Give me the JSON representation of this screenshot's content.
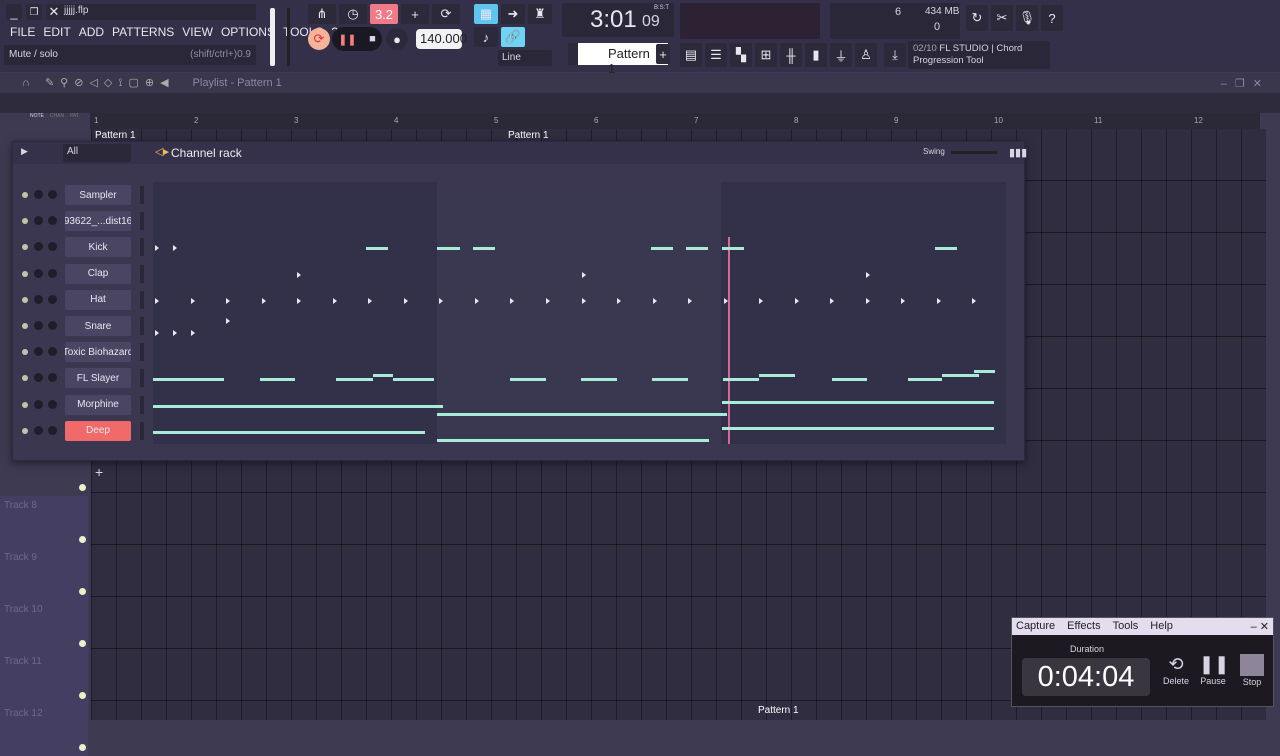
{
  "toolbar": {
    "file": "jjjjj.flp",
    "menu": [
      "FILE",
      "EDIT",
      "ADD",
      "PATTERNS",
      "VIEW",
      "OPTIONS",
      "TOOLS",
      "?"
    ],
    "hint": "Mute / solo",
    "hint_shortcut": "(shift/ctrl+)0.9",
    "tempo": "140.000",
    "time": "3:01",
    "time_sub": "09",
    "time_label": "B:S:T",
    "snap": "Line",
    "pattern": "Pattern 1",
    "cpu": "6",
    "mem": "434 MB",
    "poly": "0",
    "news": "02/10",
    "news_title": "FL STUDIO | Chord Progression Tool",
    "countdown": "3.2"
  },
  "playlist": {
    "title": "Playlist - Pattern 1",
    "tabs": [
      "NOTE",
      "CHAN",
      "PAT"
    ],
    "ruler": [
      "1",
      "2",
      "3",
      "4",
      "5",
      "6",
      "7",
      "8",
      "9",
      "10",
      "11",
      "12"
    ],
    "clips": [
      "Pattern 1",
      "Pattern 1",
      "Pattern 1"
    ],
    "tracks": [
      "Track 8",
      "Track 9",
      "Track 10",
      "Track 11",
      "Track 12"
    ]
  },
  "channel_rack": {
    "title": "Channel rack",
    "filter": "All",
    "swing": "Swing",
    "add": "+",
    "total_steps": 48,
    "channels": [
      {
        "name": "Sampler",
        "selected": false,
        "notes": [],
        "marks": []
      },
      {
        "name": "93622_...dist16",
        "selected": false,
        "notes": [],
        "marks": []
      },
      {
        "name": "Kick",
        "selected": false,
        "notes": [
          [
            12,
            1.25,
            0
          ],
          [
            16,
            1.25,
            0
          ],
          [
            18,
            1.25,
            0
          ],
          [
            28,
            1.25,
            0
          ],
          [
            30,
            1.25,
            0
          ],
          [
            32,
            1.25,
            0
          ],
          [
            44,
            1.25,
            0
          ]
        ],
        "marks": [
          [
            0,
            0
          ],
          [
            1,
            0
          ]
        ]
      },
      {
        "name": "Clap",
        "selected": false,
        "notes": [],
        "marks": [
          [
            8,
            0
          ],
          [
            24,
            0
          ],
          [
            40,
            0
          ]
        ]
      },
      {
        "name": "Hat",
        "selected": false,
        "notes": [],
        "marks": [
          [
            0,
            0
          ],
          [
            2,
            0
          ],
          [
            4,
            0
          ],
          [
            6,
            0
          ],
          [
            8,
            0
          ],
          [
            10,
            0
          ],
          [
            12,
            0
          ],
          [
            14,
            0
          ],
          [
            16,
            0
          ],
          [
            18,
            0
          ],
          [
            20,
            0
          ],
          [
            22,
            0
          ],
          [
            24,
            0
          ],
          [
            26,
            0
          ],
          [
            28,
            0
          ],
          [
            30,
            0
          ],
          [
            32,
            0
          ],
          [
            34,
            0
          ],
          [
            36,
            0
          ],
          [
            38,
            0
          ],
          [
            40,
            0
          ],
          [
            42,
            0
          ],
          [
            44,
            0
          ],
          [
            46,
            0
          ]
        ]
      },
      {
        "name": "Snare",
        "selected": false,
        "notes": [],
        "marks": [
          [
            0,
            -1
          ],
          [
            1,
            -1
          ],
          [
            2,
            -1
          ],
          [
            4,
            1
          ]
        ]
      },
      {
        "name": "Toxic Biohazard",
        "selected": false,
        "notes": [],
        "marks": []
      },
      {
        "name": "FL Slayer",
        "selected": false,
        "notes": [
          [
            0,
            2,
            0
          ],
          [
            2,
            2,
            0
          ],
          [
            6,
            2,
            0
          ],
          [
            10.3,
            2.1,
            0
          ],
          [
            12.4,
            1.1,
            1
          ],
          [
            13.5,
            2.3,
            0
          ],
          [
            20.1,
            2,
            0
          ],
          [
            24.1,
            2,
            0
          ],
          [
            28.1,
            2,
            0
          ],
          [
            32.1,
            2,
            0
          ],
          [
            34.1,
            2,
            1
          ],
          [
            38.2,
            2,
            0
          ],
          [
            42.5,
            1.9,
            0
          ],
          [
            44.4,
            2.1,
            1
          ],
          [
            46.2,
            1.2,
            2
          ]
        ]
      },
      {
        "name": "Morphine",
        "selected": false,
        "notes": [
          [
            0,
            16.3,
            0
          ],
          [
            16,
            16.3,
            -2
          ],
          [
            32,
            15.3,
            1
          ]
        ]
      },
      {
        "name": "Deep",
        "selected": true,
        "notes": [
          [
            0,
            15.3,
            0
          ],
          [
            16,
            15.3,
            -2
          ],
          [
            32,
            15.3,
            1
          ]
        ]
      }
    ]
  },
  "capture": {
    "menu": [
      "Capture",
      "Effects",
      "Tools",
      "Help"
    ],
    "duration_label": "Duration",
    "duration": "0:04:04",
    "buttons": [
      "Delete",
      "Pause",
      "Stop"
    ]
  },
  "colors": {
    "accent": "#f06a6a",
    "note": "#a8ecd8"
  }
}
